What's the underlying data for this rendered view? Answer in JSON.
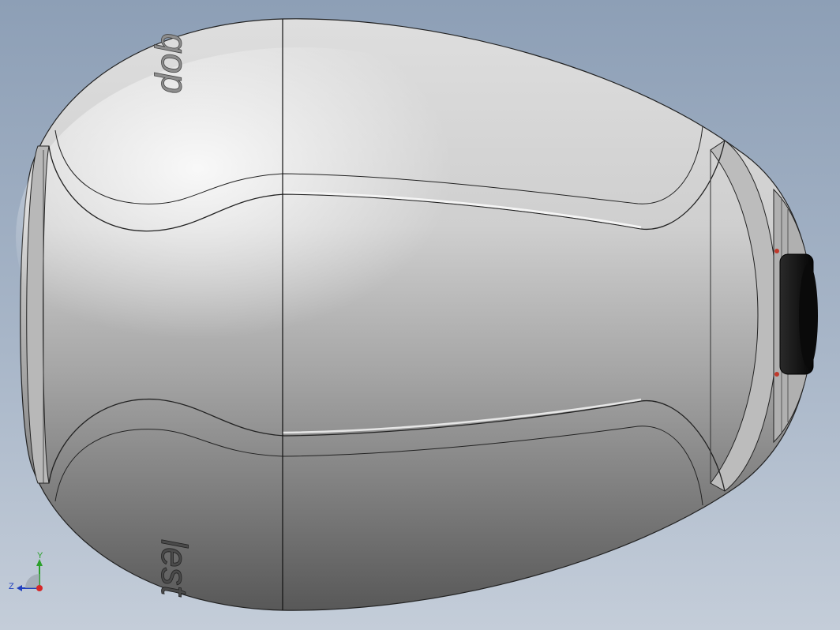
{
  "viewport": {
    "background_top": "#8d9fb6",
    "background_bottom": "#c4cdd9"
  },
  "model": {
    "body_color": "#c9c9c9",
    "edge_color": "#111111",
    "lens_color": "#1a1a1a",
    "accent_color": "#c0392b",
    "embossed_text_top": "qop",
    "embossed_text_bottom": "lest"
  },
  "triad": {
    "y_label": "Y",
    "z_label": "Z",
    "y_color": "#2ca02c",
    "z_color": "#1f3fbf",
    "x_color": "#d62728"
  }
}
